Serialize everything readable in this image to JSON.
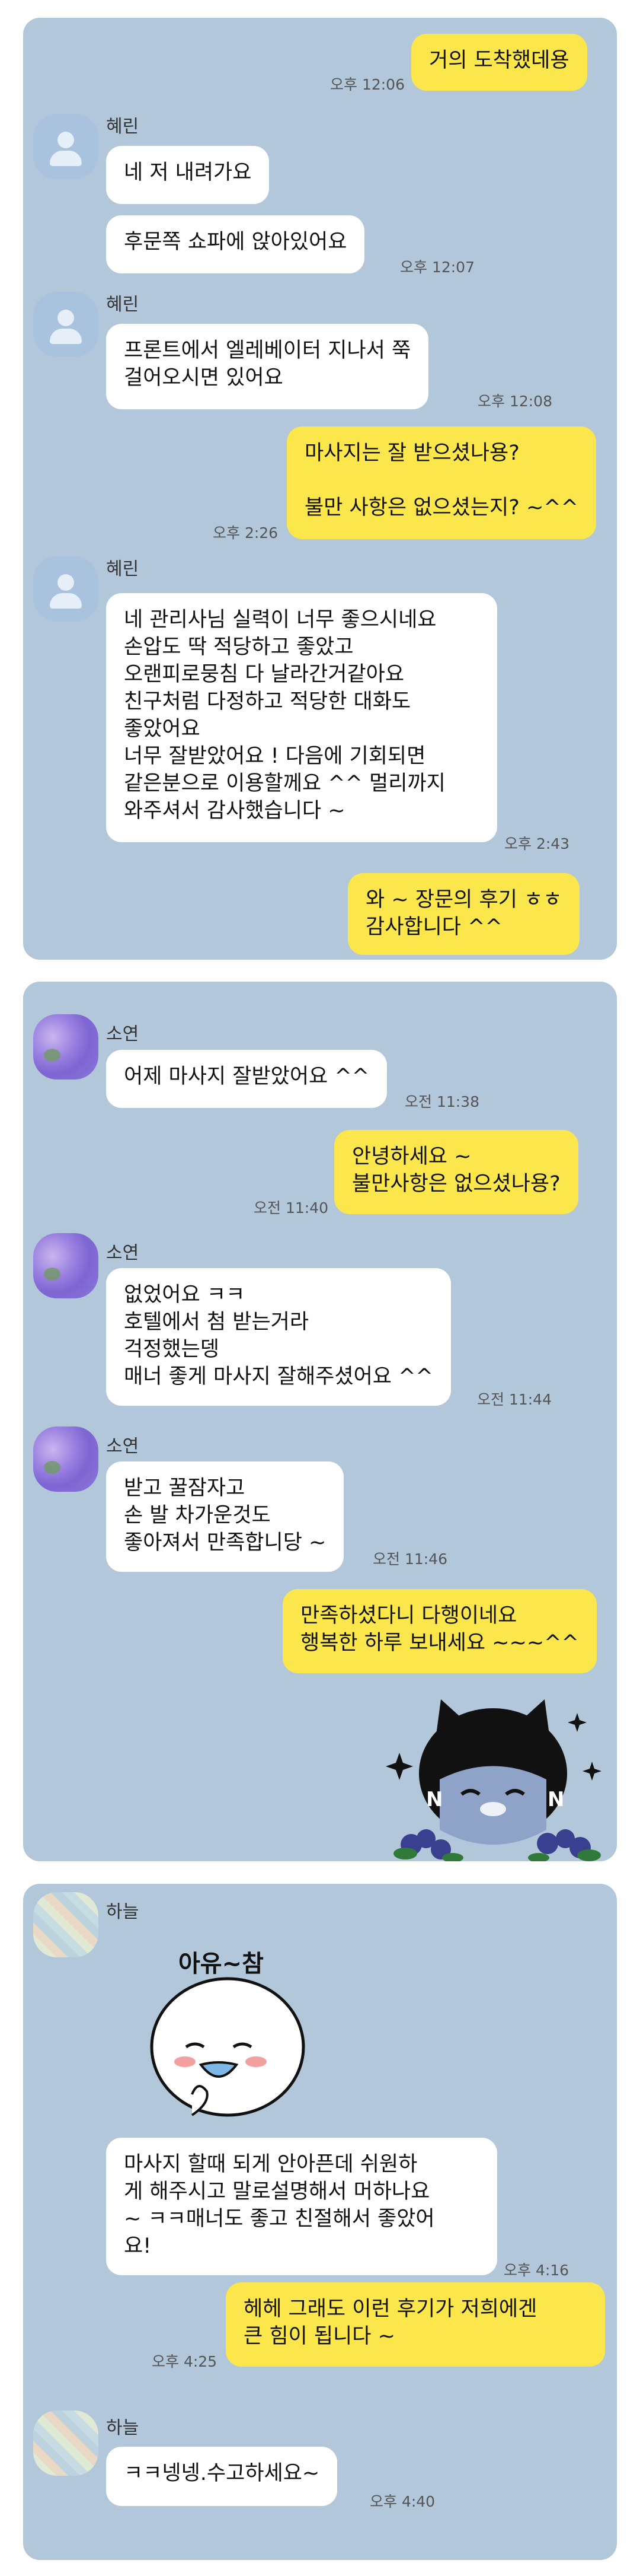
{
  "card1": {
    "m1": {
      "text": "거의 도착했데용",
      "time": "오후 12:06"
    },
    "sender": "혜린",
    "m2": {
      "text": "네 저 내려가요"
    },
    "m3": {
      "text": "후문쪽 쇼파에 앉아있어요",
      "time": "오후 12:07"
    },
    "sender2": "혜린",
    "m4": {
      "text": "프론트에서 엘레베이터 지나서 쭉\n걸어오시면 있어요",
      "time": "오후 12:08"
    },
    "m5": {
      "text": "마사지는 잘 받으셨나용?\n\n불만 사항은 없으셨는지? ~^^",
      "time": "오후 2:26"
    },
    "sender3": "혜린",
    "m6": {
      "text": "네 관리사님 실력이 너무 좋으시네요\n손압도 딱 적당하고 좋았고\n오랜피로뭉침 다 날라간거같아요\n친구처럼 다정하고 적당한 대화도\n좋았어요\n너무 잘받았어요 ! 다음에 기회되면\n같은분으로 이용할께요 ^^ 멀리까지\n와주셔서 감사했습니다 ~",
      "time": "오후 2:43"
    },
    "m7": {
      "text": "와 ~ 장문의 후기 ㅎㅎ\n감사합니다 ^^"
    }
  },
  "card2": {
    "sender": "소연",
    "m1": {
      "text": "어제 마사지 잘받았어요 ^^",
      "time": "오전 11:38"
    },
    "m2": {
      "text": "안녕하세요 ~\n불만사항은 없으셨나용?",
      "time": "오전 11:40"
    },
    "sender2": "소연",
    "m3": {
      "text": "없었어요 ㅋㅋ\n호텔에서 첨 받는거라\n걱정했는뎅\n매너 좋게 마사지 잘해주셨어요 ^^",
      "time": "오전 11:44"
    },
    "sender3": "소연",
    "m4": {
      "text": "받고 꿀잠자고\n손 발 차가운것도\n좋아져서 만족합니당 ~",
      "time": "오전 11:46"
    },
    "m5": {
      "text": "만족하셨다니 다행이네요\n행복한 하루 보내세요 ~~~^^"
    },
    "sticker_icon": "cat-character-sticker"
  },
  "card3": {
    "sender": "하늘",
    "sticker_text": "아유~참",
    "sticker_icon": "white-bean-character-sticker",
    "m1": {
      "text": "마사지 할때 되게 안아픈데 쉬원하\n게 해주시고 말로설명해서 머하나요\n~ ㅋㅋ매너도 좋고 친절해서 좋았어\n요!",
      "time": "오후 4:16"
    },
    "m2": {
      "text": "헤헤 그래도 이런 후기가 저희에겐\n큰 힘이 됩니다 ~",
      "time": "오후 4:25"
    },
    "sender2": "하늘",
    "m3": {
      "text": "ㅋㅋ넹넹.수고하세요~",
      "time": "오후 4:40"
    }
  }
}
